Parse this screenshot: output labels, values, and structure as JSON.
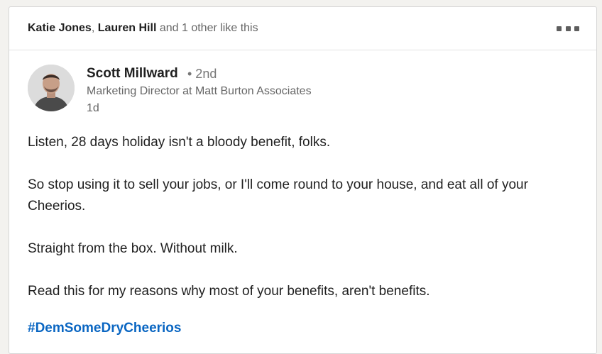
{
  "social_bar": {
    "liker_1": "Katie Jones",
    "separator": ", ",
    "liker_2": "Lauren Hill",
    "suffix": " and 1 other like this"
  },
  "post": {
    "author": {
      "name": "Scott Millward",
      "degree": "• 2nd",
      "title": "Marketing Director at Matt Burton Associates",
      "time": "1d"
    },
    "paragraphs": [
      "Listen, 28 days holiday isn't a bloody benefit, folks.",
      "So stop using it to sell your jobs, or I'll come round to your house, and eat all of your Cheerios.",
      "Straight from the box. Without milk.",
      "Read this for my reasons why most of your benefits, aren't benefits."
    ],
    "hashtag": "#DemSomeDryCheerios"
  },
  "icons": {
    "more": "more-icon"
  },
  "colors": {
    "link": "#0a66c2",
    "text": "#1f1f1f",
    "muted": "#666666"
  }
}
